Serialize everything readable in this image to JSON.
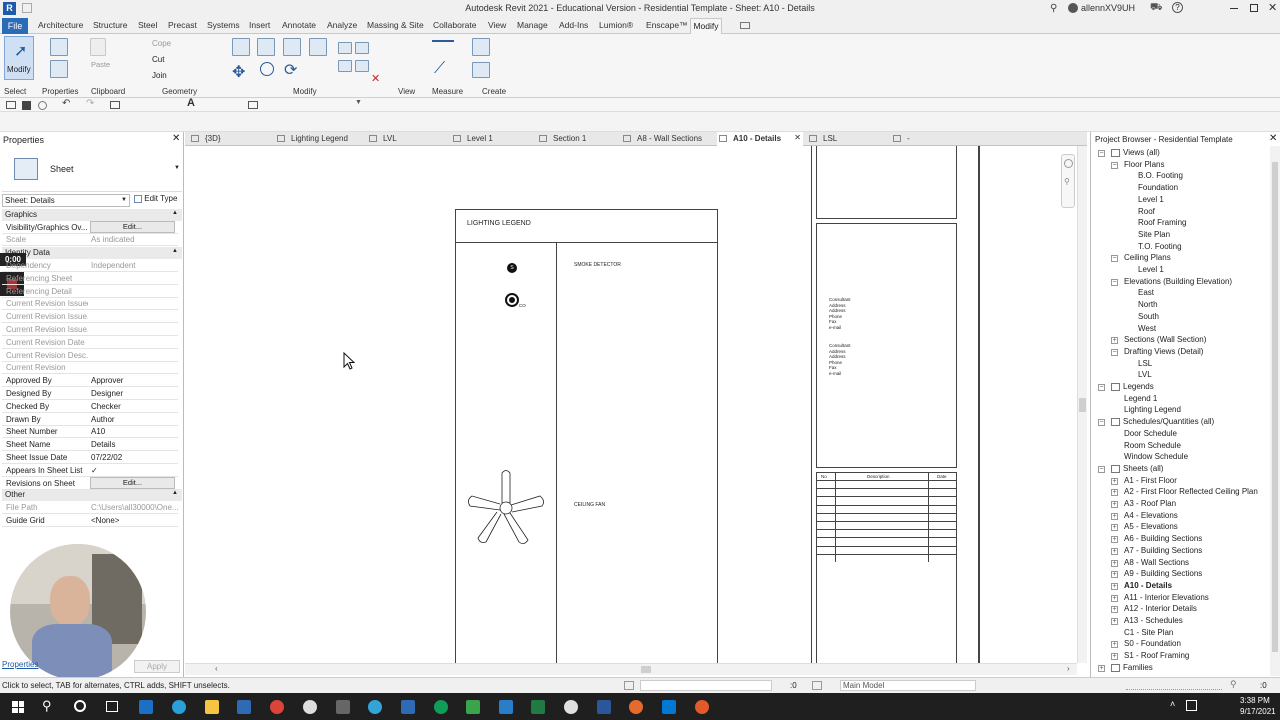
{
  "titlebar": {
    "title": "Autodesk Revit 2021 - Educational Version - Residential Template - Sheet: A10 - Details",
    "user": "allennXV9UH",
    "app_letter": "R"
  },
  "ribbon_tabs": [
    "File",
    "Architecture",
    "Structure",
    "Steel",
    "Precast",
    "Systems",
    "Insert",
    "Annotate",
    "Analyze",
    "Massing & Site",
    "Collaborate",
    "View",
    "Manage",
    "Add-Ins",
    "Lumion®",
    "Enscape™",
    "Modify"
  ],
  "active_ribbon_tab": "Modify",
  "ribbon": {
    "modify_label": "Modify",
    "paste_label": "Paste",
    "cope_label": "Cope",
    "cut_label": "Cut",
    "join_label": "Join",
    "panels": [
      "Select",
      "Properties",
      "Clipboard",
      "Geometry",
      "Modify",
      "View",
      "Measure",
      "Create"
    ]
  },
  "properties": {
    "header": "Properties",
    "type_name": "Sheet",
    "filter_value": "Sheet: Details",
    "edit_type_label": "Edit Type",
    "sections": {
      "graphics": "Graphics",
      "identity": "Identity Data",
      "other": "Other"
    },
    "timer": "0:00",
    "rows": [
      {
        "k": "Visibility/Graphics Ov...",
        "v": "Edit...",
        "button": true
      },
      {
        "k": "Scale",
        "v": "As indicated",
        "dim": true
      },
      {
        "k": "Dependency",
        "v": "Independent",
        "dim": true
      },
      {
        "k": "Referencing Sheet",
        "v": "",
        "dim": true
      },
      {
        "k": "Referencing Detail",
        "v": "",
        "dim": true
      },
      {
        "k": "Current Revision Issued",
        "v": "",
        "dim": true
      },
      {
        "k": "Current Revision Issue...",
        "v": "",
        "dim": true
      },
      {
        "k": "Current Revision Issue...",
        "v": "",
        "dim": true
      },
      {
        "k": "Current Revision Date",
        "v": "",
        "dim": true
      },
      {
        "k": "Current Revision Desc...",
        "v": "",
        "dim": true
      },
      {
        "k": "Current Revision",
        "v": "",
        "dim": true
      },
      {
        "k": "Approved By",
        "v": "Approver"
      },
      {
        "k": "Designed By",
        "v": "Designer"
      },
      {
        "k": "Checked By",
        "v": "Checker"
      },
      {
        "k": "Drawn By",
        "v": "Author"
      },
      {
        "k": "Sheet Number",
        "v": "A10"
      },
      {
        "k": "Sheet Name",
        "v": "Details"
      },
      {
        "k": "Sheet Issue Date",
        "v": "07/22/02"
      },
      {
        "k": "Appears In Sheet List",
        "v": "✓"
      },
      {
        "k": "Revisions on Sheet",
        "v": "Edit...",
        "button": true
      },
      {
        "k": "File Path",
        "v": "C:\\Users\\all30000\\One...",
        "dim": true
      },
      {
        "k": "Guide Grid",
        "v": "<None>"
      }
    ],
    "properties_link": "Properties",
    "apply_label": "Apply"
  },
  "view_tabs": [
    {
      "label": "{3D}",
      "icon": "3d-view-icon"
    },
    {
      "label": "Lighting Legend",
      "icon": "legend-icon"
    },
    {
      "label": "LVL",
      "icon": "drafting-icon"
    },
    {
      "label": "Level 1",
      "icon": "plan-icon"
    },
    {
      "label": "Section 1",
      "icon": "section-icon"
    },
    {
      "label": "A8 - Wall Sections",
      "icon": "sheet-icon"
    },
    {
      "label": "A10 - Details",
      "icon": "sheet-icon",
      "active": true
    },
    {
      "label": "LSL",
      "icon": "drafting-icon"
    },
    {
      "label": "-",
      "icon": "sheet-icon"
    }
  ],
  "sheet": {
    "legend_title": "LIGHTING LEGEND",
    "smoke_detector": "SMOKE DETECTOR",
    "smoke_symbol": "S",
    "co_label": "CO",
    "ceiling_fan": "CEILING FAN",
    "consultant_block": [
      "Consultant",
      "Address",
      "Address",
      "Phone",
      "Fax",
      "e-mail"
    ],
    "revision_headers": [
      "No",
      "Description",
      "Date"
    ]
  },
  "project_browser": {
    "header": "Project Browser - Residential Template",
    "tree": [
      {
        "label": "Views (all)",
        "depth": 0,
        "exp": "-"
      },
      {
        "label": "Floor Plans",
        "depth": 1,
        "exp": "-"
      },
      {
        "label": "B.O. Footing",
        "depth": 2
      },
      {
        "label": "Foundation",
        "depth": 2
      },
      {
        "label": "Level 1",
        "depth": 2
      },
      {
        "label": "Roof",
        "depth": 2
      },
      {
        "label": "Roof Framing",
        "depth": 2
      },
      {
        "label": "Site Plan",
        "depth": 2
      },
      {
        "label": "T.O. Footing",
        "depth": 2
      },
      {
        "label": "Ceiling Plans",
        "depth": 1,
        "exp": "-"
      },
      {
        "label": "Level 1",
        "depth": 2
      },
      {
        "label": "Elevations (Building Elevation)",
        "depth": 1,
        "exp": "-"
      },
      {
        "label": "East",
        "depth": 2
      },
      {
        "label": "North",
        "depth": 2
      },
      {
        "label": "South",
        "depth": 2
      },
      {
        "label": "West",
        "depth": 2
      },
      {
        "label": "Sections (Wall Section)",
        "depth": 1,
        "exp": "+"
      },
      {
        "label": "Drafting Views (Detail)",
        "depth": 1,
        "exp": "-"
      },
      {
        "label": "LSL",
        "depth": 2
      },
      {
        "label": "LVL",
        "depth": 2
      },
      {
        "label": "Legends",
        "depth": 0,
        "exp": "-"
      },
      {
        "label": "Legend 1",
        "depth": 1
      },
      {
        "label": "Lighting Legend",
        "depth": 1
      },
      {
        "label": "Schedules/Quantities (all)",
        "depth": 0,
        "exp": "-"
      },
      {
        "label": "Door Schedule",
        "depth": 1
      },
      {
        "label": "Room Schedule",
        "depth": 1
      },
      {
        "label": "Window Schedule",
        "depth": 1
      },
      {
        "label": "Sheets (all)",
        "depth": 0,
        "exp": "-"
      },
      {
        "label": "A1 - First Floor",
        "depth": 1,
        "exp": "+"
      },
      {
        "label": "A2 - First Floor Reflected Ceiling Plan",
        "depth": 1,
        "exp": "+"
      },
      {
        "label": "A3 - Roof Plan",
        "depth": 1,
        "exp": "+"
      },
      {
        "label": "A4 - Elevations",
        "depth": 1,
        "exp": "+"
      },
      {
        "label": "A5 - Elevations",
        "depth": 1,
        "exp": "+"
      },
      {
        "label": "A6 - Building Sections",
        "depth": 1,
        "exp": "+"
      },
      {
        "label": "A7 - Building Sections",
        "depth": 1,
        "exp": "+"
      },
      {
        "label": "A8 - Wall Sections",
        "depth": 1,
        "exp": "+"
      },
      {
        "label": "A9 - Building Sections",
        "depth": 1,
        "exp": "+"
      },
      {
        "label": "A10 - Details",
        "depth": 1,
        "exp": "+",
        "bold": true
      },
      {
        "label": "A11 - Interior Elevations",
        "depth": 1,
        "exp": "+"
      },
      {
        "label": "A12 - Interior Details",
        "depth": 1,
        "exp": "+"
      },
      {
        "label": "A13 - Schedules",
        "depth": 1,
        "exp": "+"
      },
      {
        "label": "C1 - Site Plan",
        "depth": 1
      },
      {
        "label": "S0 - Foundation",
        "depth": 1,
        "exp": "+"
      },
      {
        "label": "S1 - Roof Framing",
        "depth": 1,
        "exp": "+"
      },
      {
        "label": "Families",
        "depth": 0,
        "exp": "+"
      }
    ]
  },
  "statusbar": {
    "hint": "Click to select, TAB for alternates, CTRL adds, SHIFT unselects.",
    "zero1": ":0",
    "model": "Main Model",
    "zero2": ":0"
  },
  "taskbar": {
    "time": "3:38 PM",
    "date": "9/17/2021"
  },
  "colors": {
    "file_tab": "#2b6cb8",
    "accent": "#1e5aa8",
    "taskbar": "#1f1f1f"
  }
}
